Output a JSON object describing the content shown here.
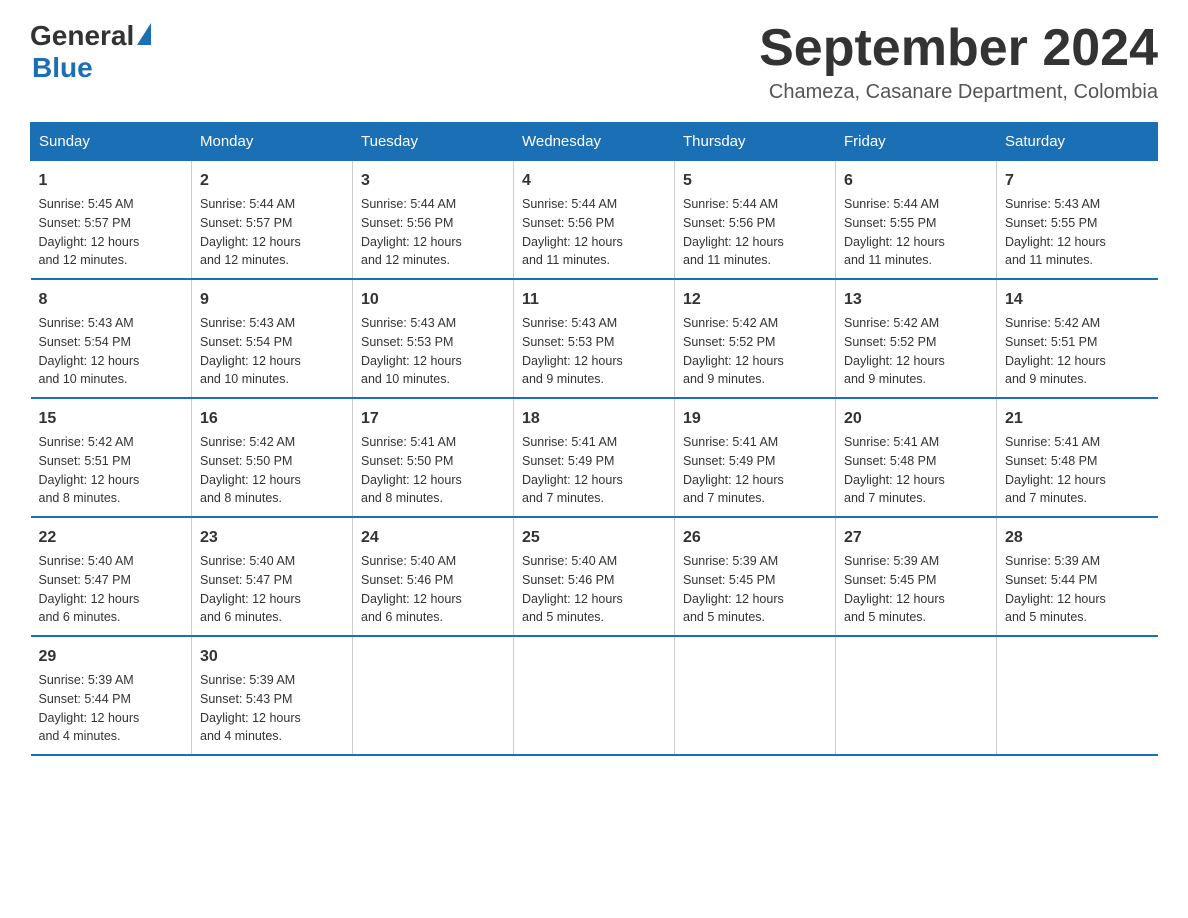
{
  "logo": {
    "general": "General",
    "blue": "Blue"
  },
  "title": "September 2024",
  "location": "Chameza, Casanare Department, Colombia",
  "days_of_week": [
    "Sunday",
    "Monday",
    "Tuesday",
    "Wednesday",
    "Thursday",
    "Friday",
    "Saturday"
  ],
  "weeks": [
    [
      {
        "day": "1",
        "sunrise": "5:45 AM",
        "sunset": "5:57 PM",
        "daylight": "12 hours and 12 minutes."
      },
      {
        "day": "2",
        "sunrise": "5:44 AM",
        "sunset": "5:57 PM",
        "daylight": "12 hours and 12 minutes."
      },
      {
        "day": "3",
        "sunrise": "5:44 AM",
        "sunset": "5:56 PM",
        "daylight": "12 hours and 12 minutes."
      },
      {
        "day": "4",
        "sunrise": "5:44 AM",
        "sunset": "5:56 PM",
        "daylight": "12 hours and 11 minutes."
      },
      {
        "day": "5",
        "sunrise": "5:44 AM",
        "sunset": "5:56 PM",
        "daylight": "12 hours and 11 minutes."
      },
      {
        "day": "6",
        "sunrise": "5:44 AM",
        "sunset": "5:55 PM",
        "daylight": "12 hours and 11 minutes."
      },
      {
        "day": "7",
        "sunrise": "5:43 AM",
        "sunset": "5:55 PM",
        "daylight": "12 hours and 11 minutes."
      }
    ],
    [
      {
        "day": "8",
        "sunrise": "5:43 AM",
        "sunset": "5:54 PM",
        "daylight": "12 hours and 10 minutes."
      },
      {
        "day": "9",
        "sunrise": "5:43 AM",
        "sunset": "5:54 PM",
        "daylight": "12 hours and 10 minutes."
      },
      {
        "day": "10",
        "sunrise": "5:43 AM",
        "sunset": "5:53 PM",
        "daylight": "12 hours and 10 minutes."
      },
      {
        "day": "11",
        "sunrise": "5:43 AM",
        "sunset": "5:53 PM",
        "daylight": "12 hours and 9 minutes."
      },
      {
        "day": "12",
        "sunrise": "5:42 AM",
        "sunset": "5:52 PM",
        "daylight": "12 hours and 9 minutes."
      },
      {
        "day": "13",
        "sunrise": "5:42 AM",
        "sunset": "5:52 PM",
        "daylight": "12 hours and 9 minutes."
      },
      {
        "day": "14",
        "sunrise": "5:42 AM",
        "sunset": "5:51 PM",
        "daylight": "12 hours and 9 minutes."
      }
    ],
    [
      {
        "day": "15",
        "sunrise": "5:42 AM",
        "sunset": "5:51 PM",
        "daylight": "12 hours and 8 minutes."
      },
      {
        "day": "16",
        "sunrise": "5:42 AM",
        "sunset": "5:50 PM",
        "daylight": "12 hours and 8 minutes."
      },
      {
        "day": "17",
        "sunrise": "5:41 AM",
        "sunset": "5:50 PM",
        "daylight": "12 hours and 8 minutes."
      },
      {
        "day": "18",
        "sunrise": "5:41 AM",
        "sunset": "5:49 PM",
        "daylight": "12 hours and 7 minutes."
      },
      {
        "day": "19",
        "sunrise": "5:41 AM",
        "sunset": "5:49 PM",
        "daylight": "12 hours and 7 minutes."
      },
      {
        "day": "20",
        "sunrise": "5:41 AM",
        "sunset": "5:48 PM",
        "daylight": "12 hours and 7 minutes."
      },
      {
        "day": "21",
        "sunrise": "5:41 AM",
        "sunset": "5:48 PM",
        "daylight": "12 hours and 7 minutes."
      }
    ],
    [
      {
        "day": "22",
        "sunrise": "5:40 AM",
        "sunset": "5:47 PM",
        "daylight": "12 hours and 6 minutes."
      },
      {
        "day": "23",
        "sunrise": "5:40 AM",
        "sunset": "5:47 PM",
        "daylight": "12 hours and 6 minutes."
      },
      {
        "day": "24",
        "sunrise": "5:40 AM",
        "sunset": "5:46 PM",
        "daylight": "12 hours and 6 minutes."
      },
      {
        "day": "25",
        "sunrise": "5:40 AM",
        "sunset": "5:46 PM",
        "daylight": "12 hours and 5 minutes."
      },
      {
        "day": "26",
        "sunrise": "5:39 AM",
        "sunset": "5:45 PM",
        "daylight": "12 hours and 5 minutes."
      },
      {
        "day": "27",
        "sunrise": "5:39 AM",
        "sunset": "5:45 PM",
        "daylight": "12 hours and 5 minutes."
      },
      {
        "day": "28",
        "sunrise": "5:39 AM",
        "sunset": "5:44 PM",
        "daylight": "12 hours and 5 minutes."
      }
    ],
    [
      {
        "day": "29",
        "sunrise": "5:39 AM",
        "sunset": "5:44 PM",
        "daylight": "12 hours and 4 minutes."
      },
      {
        "day": "30",
        "sunrise": "5:39 AM",
        "sunset": "5:43 PM",
        "daylight": "12 hours and 4 minutes."
      },
      null,
      null,
      null,
      null,
      null
    ]
  ]
}
